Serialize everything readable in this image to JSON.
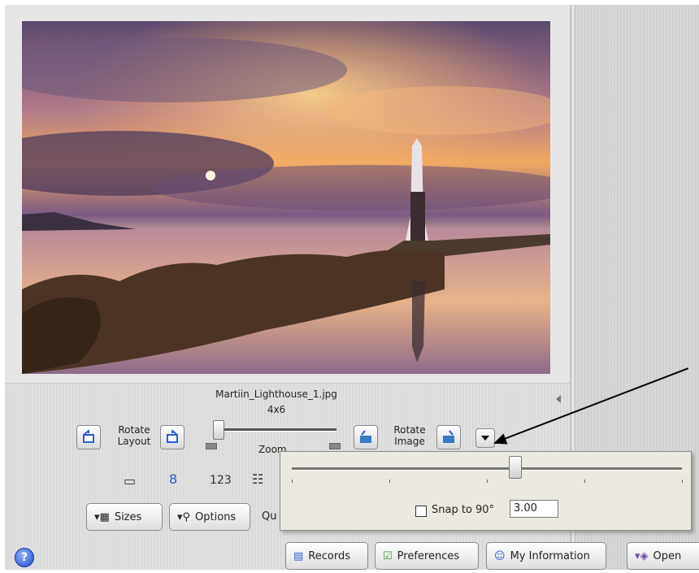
{
  "image": {
    "filename": "Martiin_Lighthouse_1.jpg",
    "size": "4x6"
  },
  "layout_controls": {
    "rotate_layout_line1": "Rotate",
    "rotate_layout_line2": "Layout",
    "zoom_label": "Zoom",
    "rotate_image_line1": "Rotate",
    "rotate_image_line2": "Image"
  },
  "tools": {
    "numbering_label": "123"
  },
  "buttons": {
    "sizes": "Sizes",
    "options": "Options",
    "quality_partial": "Qu",
    "records": "Records",
    "preferences": "Preferences",
    "my_information": "My Information",
    "open_partial": "Open"
  },
  "rotation_popup": {
    "snap_label": "Snap to 90°",
    "snap_checked": false,
    "angle_value": "3.00",
    "slider_fraction": 0.57
  },
  "help": {
    "label": "?"
  },
  "colors": {
    "accent_blue": "#2a5bd7",
    "help_blue": "#1f48c9"
  }
}
